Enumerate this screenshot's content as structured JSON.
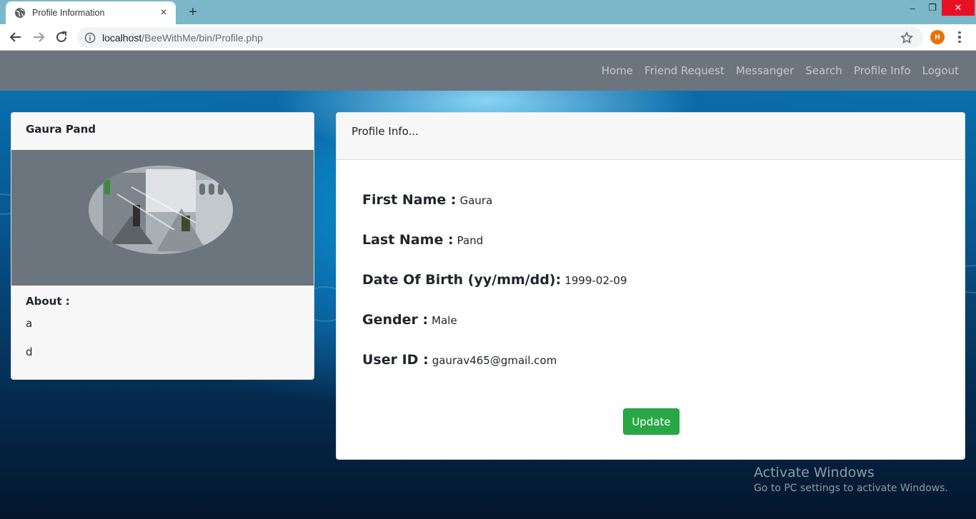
{
  "browser": {
    "tab_title": "Profile Information",
    "tab_close": "×",
    "new_tab": "+",
    "url_host": "localhost",
    "url_path": "/BeeWithMe/bin/Profile.php",
    "profile_initial": "H",
    "window_controls": {
      "minimize": "–",
      "restore": "❐",
      "close": "✕"
    }
  },
  "navbar": {
    "links": [
      "Home",
      "Friend Request",
      "Messanger",
      "Search",
      "Profile Info",
      "Logout"
    ]
  },
  "profile_card": {
    "name": "Gaura Pand",
    "about_label": "About :",
    "about_lines": [
      "a",
      "d"
    ]
  },
  "info_card": {
    "title": "Profile Info...",
    "fields": [
      {
        "label": "First Name :",
        "value": "Gaura"
      },
      {
        "label": "Last Name :",
        "value": "Pand"
      },
      {
        "label": "Date Of Birth (yy/mm/dd):",
        "value": "1999-02-09"
      },
      {
        "label": "Gender :",
        "value": "Male"
      },
      {
        "label": "User ID :",
        "value": "gaurav465@gmail.com"
      }
    ],
    "update_label": "Update"
  },
  "watermark": {
    "line1": "Activate Windows",
    "line2": "Go to PC settings to activate Windows."
  },
  "colors": {
    "navbar": "#6c757d",
    "card_header": "#f7f7f7",
    "update_button": "#28a745",
    "tab_strip": "#7cb7c9",
    "profile_avatar": "#e8710a"
  }
}
